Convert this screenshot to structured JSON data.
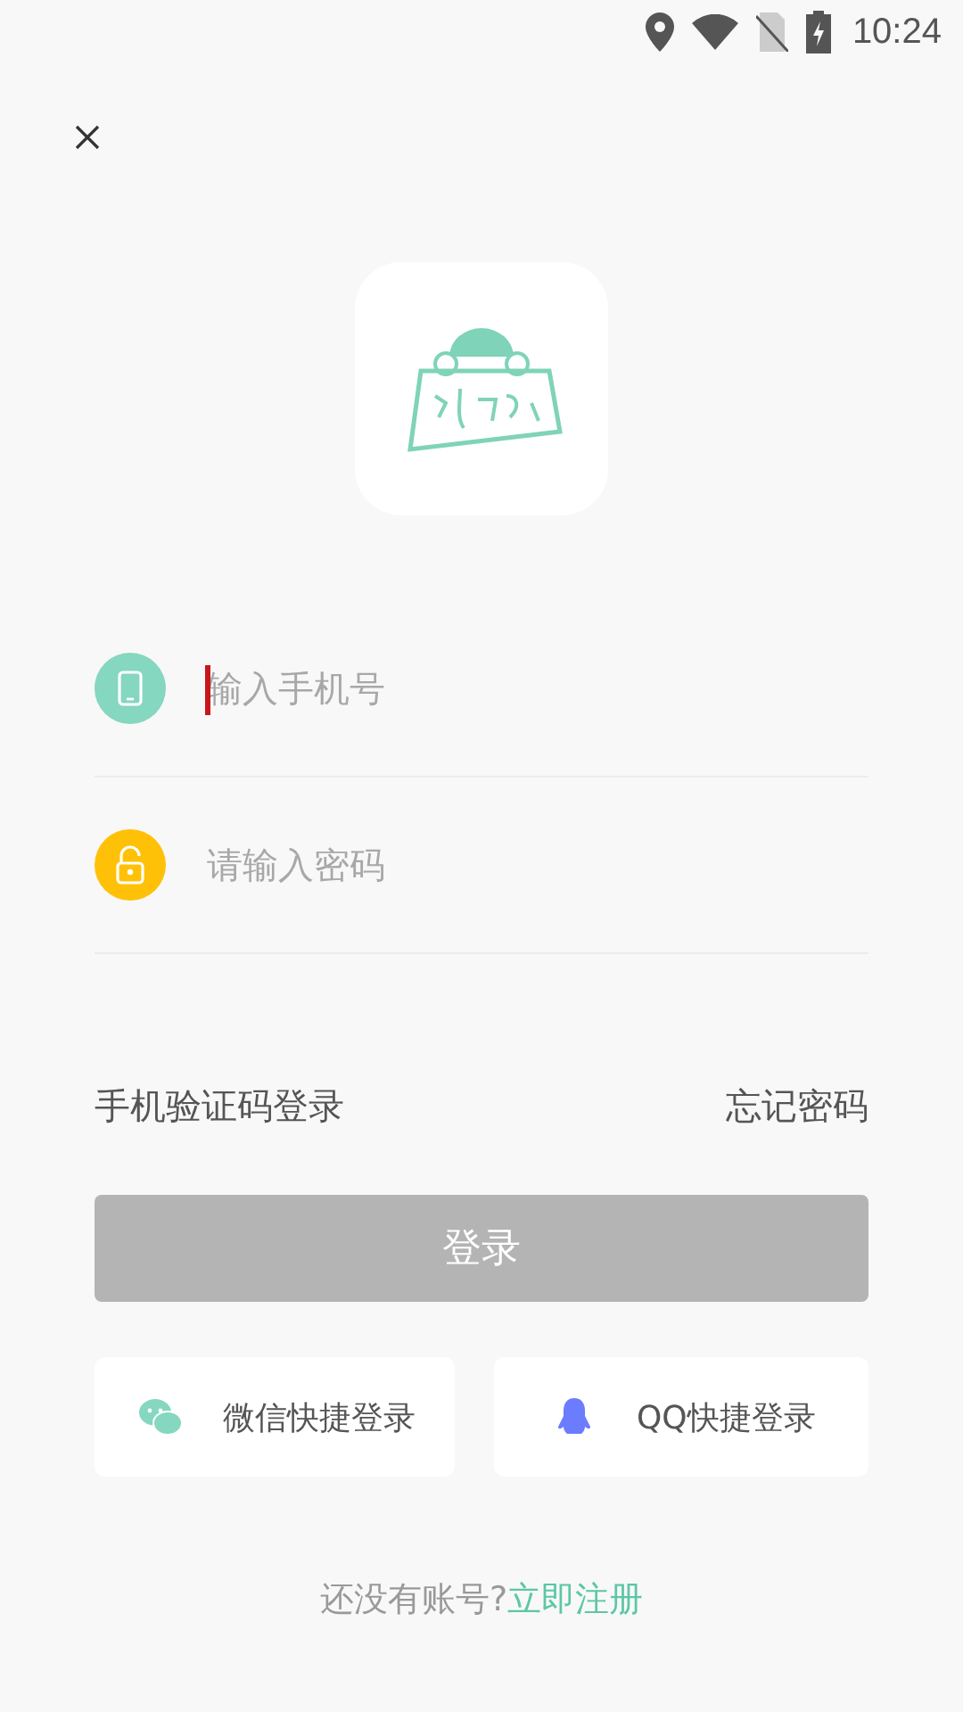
{
  "status_bar": {
    "time": "10:24"
  },
  "fields": [
    {
      "kind": "phone",
      "placeholder": "输入手机号",
      "focused": true
    },
    {
      "kind": "lock",
      "placeholder": "请输入密码",
      "focused": false
    }
  ],
  "links": {
    "sms_login": "手机验证码登录",
    "forgot_password": "忘记密码"
  },
  "login_button": {
    "label": "登录",
    "disabled": true
  },
  "quick_logins": [
    {
      "kind": "wechat",
      "label": "微信快捷登录"
    },
    {
      "kind": "qq",
      "label": "QQ快捷登录"
    }
  ],
  "footer": {
    "prompt": "还没有账号?",
    "link": "立即注册"
  }
}
